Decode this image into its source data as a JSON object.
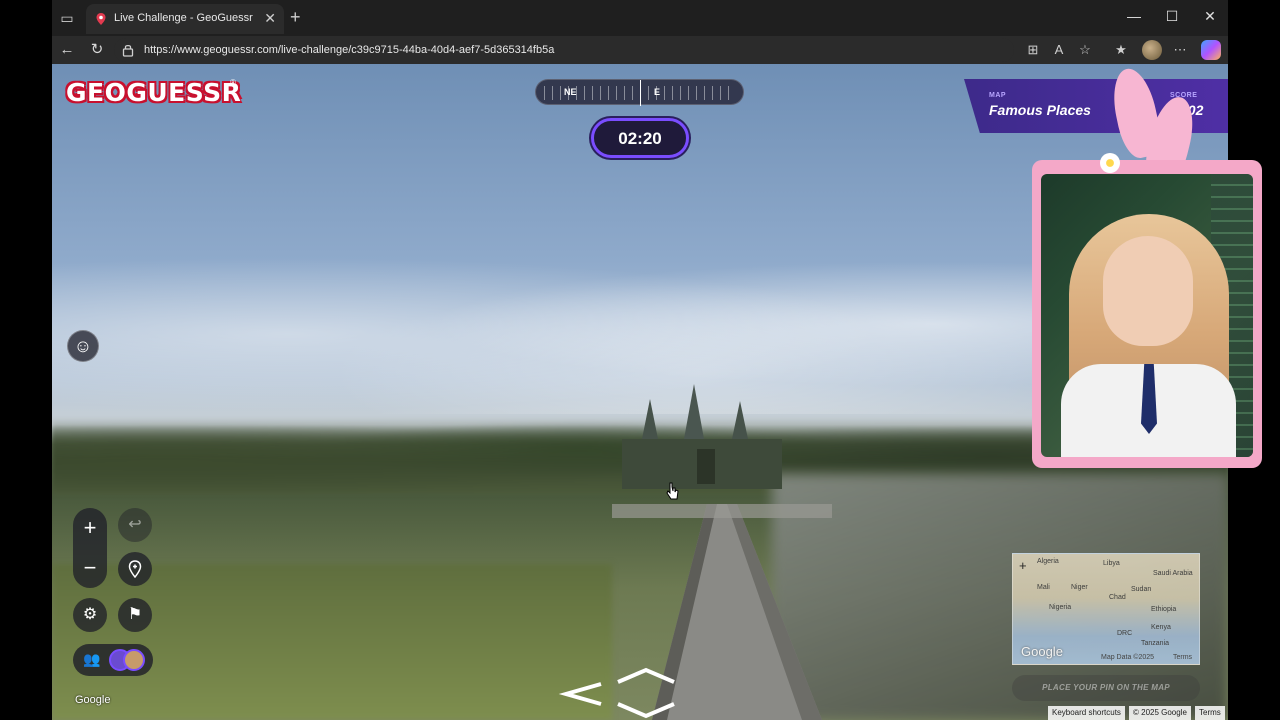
{
  "browser": {
    "tab_title": "Live Challenge - GeoGuessr",
    "url": "https://www.geoguessr.com/live-challenge/c39c9715-44ba-40d4-aef7-5d365314fb5a"
  },
  "game": {
    "logo_text": "GEOGUESSR",
    "logo_reg": "®",
    "compass": {
      "left_label": "NE",
      "right_label": "E"
    },
    "timer": "02:20",
    "map_label": "MAP",
    "map_value": "Famous Places",
    "score_label": "SCORE",
    "score_value": "002",
    "google_watermark": "Google",
    "place_pin_button": "PLACE YOUR PIN ON THE MAP",
    "minimap": {
      "labels": [
        "Algeria",
        "Libya",
        "Saudi Arabia",
        "Mali",
        "Niger",
        "Sudan",
        "Chad",
        "Nigeria",
        "Ethiopia",
        "Kenya",
        "DRC",
        "Tanzania"
      ],
      "google": "Google",
      "map_data": "Map Data ©2025",
      "terms": "Terms"
    },
    "bottom_bar": {
      "keyboard": "Keyboard shortcuts",
      "copyright": "© 2025 Google",
      "terms": "Terms"
    }
  },
  "colors": {
    "accent_purple": "#7a4dff",
    "logo_red": "#c8102e",
    "webcam_pink": "#f4a8c8"
  }
}
